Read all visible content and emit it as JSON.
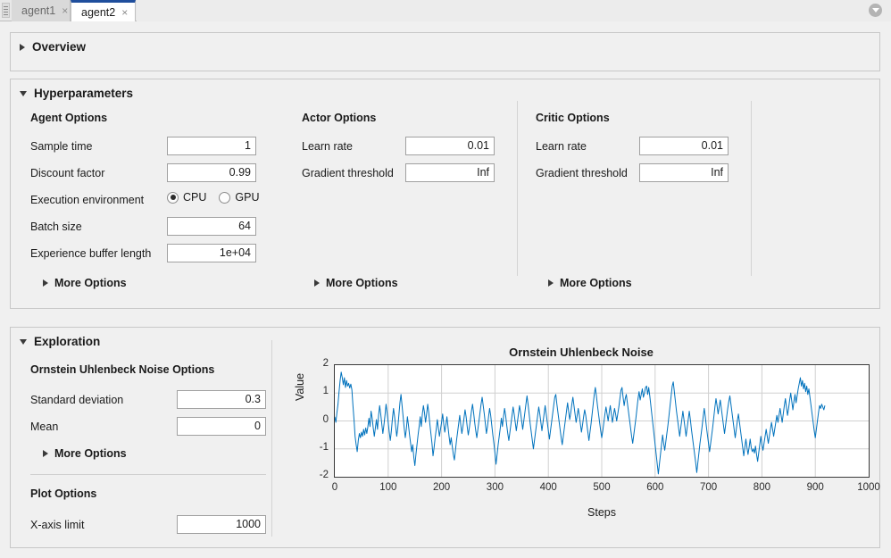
{
  "tabs": {
    "items": [
      {
        "label": "agent1",
        "close": "×",
        "active": false
      },
      {
        "label": "agent2",
        "close": "×",
        "active": true
      }
    ],
    "menu_icon": "chevron-down-circle-icon"
  },
  "sections": {
    "overview": {
      "title": "Overview",
      "expanded": false
    },
    "hyperparameters": {
      "title": "Hyperparameters",
      "expanded": true
    },
    "exploration": {
      "title": "Exploration",
      "expanded": true
    }
  },
  "agent_options": {
    "group_label": "Agent Options",
    "sample_time": {
      "label": "Sample time",
      "value": "1"
    },
    "discount_factor": {
      "label": "Discount factor",
      "value": "0.99"
    },
    "execution_environment": {
      "label": "Execution environment",
      "options": [
        "CPU",
        "GPU"
      ],
      "selected": "CPU"
    },
    "batch_size": {
      "label": "Batch size",
      "value": "64"
    },
    "experience_buffer_length": {
      "label": "Experience buffer length",
      "value": "1e+04"
    },
    "more_options": "More Options"
  },
  "actor_options": {
    "group_label": "Actor Options",
    "learn_rate": {
      "label": "Learn rate",
      "value": "0.01"
    },
    "gradient_threshold": {
      "label": "Gradient threshold",
      "value": "Inf"
    },
    "more_options": "More Options"
  },
  "critic_options": {
    "group_label": "Critic Options",
    "learn_rate": {
      "label": "Learn rate",
      "value": "0.01"
    },
    "gradient_threshold": {
      "label": "Gradient threshold",
      "value": "Inf"
    },
    "more_options": "More Options"
  },
  "exploration": {
    "noise_group_label": "Ornstein Uhlenbeck Noise Options",
    "standard_deviation": {
      "label": "Standard deviation",
      "value": "0.3"
    },
    "mean": {
      "label": "Mean",
      "value": "0"
    },
    "more_options": "More Options",
    "plot_group_label": "Plot Options",
    "x_axis_limit": {
      "label": "X-axis limit",
      "value": "1000"
    }
  },
  "chart_data": {
    "type": "line",
    "title": "Ornstein Uhlenbeck Noise",
    "xlabel": "Steps",
    "ylabel": "Value",
    "xlim": [
      0,
      1000
    ],
    "ylim": [
      -2,
      2
    ],
    "xticks": [
      0,
      100,
      200,
      300,
      400,
      500,
      600,
      700,
      800,
      900,
      1000
    ],
    "yticks": [
      -2,
      -1,
      0,
      1,
      2
    ],
    "grid": true,
    "legend": null,
    "series": [
      {
        "name": "Ornstein Uhlenbeck Noise",
        "color": "#0072BD",
        "x_step": 2,
        "values": [
          0.15,
          -0.05,
          0.3,
          0.6,
          1.05,
          1.45,
          1.75,
          1.55,
          1.3,
          1.55,
          1.2,
          1.45,
          1.25,
          1.35,
          1.18,
          1.32,
          1.12,
          0.55,
          0.05,
          -0.55,
          -0.85,
          -1.1,
          -0.7,
          -0.45,
          -0.6,
          -0.4,
          -0.55,
          -0.3,
          -0.5,
          -0.25,
          -0.45,
          -0.2,
          0.1,
          -0.2,
          0.35,
          0.1,
          -0.25,
          -0.55,
          -0.25,
          0.05,
          -0.3,
          0.2,
          0.55,
          0.25,
          -0.1,
          -0.45,
          -0.15,
          0.2,
          0.6,
          0.3,
          -0.05,
          -0.4,
          -0.7,
          -0.35,
          0.1,
          0.45,
          0.15,
          -0.2,
          -0.55,
          -0.25,
          0.2,
          0.65,
          0.95,
          0.55,
          0.15,
          -0.25,
          -0.6,
          -0.3,
          0.15,
          -0.15,
          -0.5,
          -0.8,
          -1.1,
          -0.85,
          -1.3,
          -1.6,
          -1.2,
          -0.85,
          -0.5,
          -0.2,
          0.15,
          -0.2,
          0.25,
          0.55,
          0.3,
          -0.05,
          0.25,
          0.6,
          0.3,
          -0.1,
          -0.45,
          -0.8,
          -1.25,
          -0.95,
          -0.6,
          -0.3,
          0.05,
          -0.25,
          -0.55,
          -0.3,
          -0.05,
          0.25,
          -0.1,
          -0.4,
          -0.15,
          0.15,
          -0.2,
          -0.55,
          -0.85,
          -0.6,
          -0.9,
          -1.2,
          -1.4,
          -1.05,
          -0.7,
          -0.4,
          -0.1,
          0.2,
          -0.15,
          -0.45,
          -0.2,
          0.1,
          0.4,
          0.15,
          -0.2,
          -0.5,
          -0.25,
          0.05,
          0.35,
          0.6,
          0.3,
          -0.05,
          -0.35,
          -0.6,
          -0.3,
          0.0,
          0.3,
          0.6,
          0.85,
          0.55,
          0.25,
          -0.1,
          -0.45,
          -0.2,
          0.15,
          0.45,
          0.2,
          -0.15,
          -0.5,
          -0.8,
          -1.15,
          -1.55,
          -1.2,
          -0.85,
          -0.55,
          -0.25,
          0.1,
          -0.2,
          0.15,
          0.45,
          0.2,
          -0.15,
          -0.45,
          -0.7,
          -0.4,
          -0.1,
          0.2,
          0.5,
          0.25,
          -0.05,
          -0.35,
          -0.05,
          0.25,
          0.55,
          0.3,
          0.0,
          -0.3,
          0.0,
          0.3,
          0.6,
          0.9,
          0.6,
          0.25,
          -0.1,
          -0.4,
          -0.7,
          -1.0,
          -0.7,
          -0.4,
          -0.1,
          0.2,
          0.5,
          0.25,
          -0.05,
          -0.35,
          -0.05,
          0.25,
          0.55,
          0.25,
          -0.05,
          -0.35,
          -0.65,
          -0.35,
          -0.05,
          0.25,
          0.55,
          0.85,
          0.95,
          0.6,
          0.3,
          0.0,
          -0.3,
          -0.6,
          -0.85,
          -0.55,
          -0.25,
          0.05,
          0.35,
          0.65,
          0.35,
          0.05,
          0.3,
          0.6,
          0.85,
          0.55,
          0.25,
          -0.05,
          0.2,
          0.45,
          0.2,
          -0.1,
          -0.4,
          -0.15,
          0.15,
          0.4,
          0.2,
          -0.1,
          -0.4,
          -0.7,
          -0.4,
          -0.1,
          0.25,
          0.6,
          0.95,
          1.2,
          0.9,
          0.55,
          0.25,
          -0.05,
          -0.35,
          -0.6,
          -0.35,
          -0.05,
          0.25,
          0.5,
          0.25,
          0.0,
          0.3,
          0.55,
          0.25,
          -0.05,
          0.2,
          0.45,
          0.25,
          0.0,
          0.25,
          0.5,
          0.8,
          1.1,
          1.2,
          0.85,
          0.55,
          0.8,
          0.95,
          0.65,
          0.35,
          0.05,
          -0.25,
          -0.55,
          -0.8,
          -0.5,
          -0.2,
          0.1,
          0.45,
          0.8,
          1.05,
          0.75,
          0.95,
          1.15,
          0.85,
          1.0,
          1.2,
          1.25,
          0.95,
          1.2,
          0.9,
          0.55,
          0.2,
          -0.15,
          -0.5,
          -0.85,
          -1.2,
          -1.55,
          -1.9,
          -1.55,
          -1.2,
          -0.85,
          -0.5,
          -0.8,
          -1.05,
          -0.75,
          -0.45,
          -0.15,
          0.2,
          0.55,
          0.9,
          1.25,
          1.4,
          1.05,
          0.7,
          0.35,
          0.05,
          -0.25,
          -0.55,
          -0.25,
          0.05,
          0.35,
          0.05,
          -0.25,
          -0.55,
          -0.25,
          0.05,
          0.35,
          0.05,
          -0.3,
          -0.6,
          -0.9,
          -1.2,
          -1.5,
          -1.85,
          -1.5,
          -1.15,
          -0.8,
          -0.5,
          -0.2,
          0.15,
          0.45,
          0.15,
          -0.2,
          -0.5,
          -0.8,
          -1.1,
          -0.8,
          -0.5,
          -0.2,
          0.15,
          0.5,
          0.8,
          0.55,
          0.25,
          0.5,
          0.75,
          0.45,
          0.15,
          -0.15,
          -0.45,
          -0.15,
          0.15,
          0.45,
          0.7,
          0.9,
          0.6,
          0.3,
          0.0,
          -0.3,
          -0.6,
          -0.3,
          0.0,
          0.25,
          -0.05,
          -0.35,
          -0.65,
          -0.95,
          -1.25,
          -0.95,
          -0.65,
          -0.95,
          -1.2,
          -0.95,
          -0.65,
          -0.95,
          -1.1,
          -1.0,
          -1.15,
          -0.9,
          -1.2,
          -1.45,
          -1.15,
          -0.85,
          -0.55,
          -0.85,
          -1.05,
          -0.8,
          -0.55,
          -0.3,
          -0.55,
          -0.8,
          -0.55,
          -0.3,
          -0.05,
          -0.3,
          -0.55,
          -0.3,
          -0.05,
          0.2,
          -0.05,
          0.2,
          0.45,
          0.2,
          -0.05,
          0.25,
          0.55,
          0.8,
          0.5,
          0.2,
          0.45,
          0.75,
          1.0,
          0.7,
          0.4,
          0.7,
          0.95,
          0.65,
          0.9,
          1.15,
          1.35,
          1.55,
          1.25,
          1.45,
          1.15,
          1.35,
          1.05,
          1.25,
          0.95,
          1.15,
          0.85,
          0.55,
          0.25,
          -0.05,
          -0.35,
          -0.6,
          -0.3,
          0.0,
          0.3,
          0.55,
          0.45,
          0.6,
          0.5,
          0.4,
          0.55
        ]
      }
    ]
  }
}
